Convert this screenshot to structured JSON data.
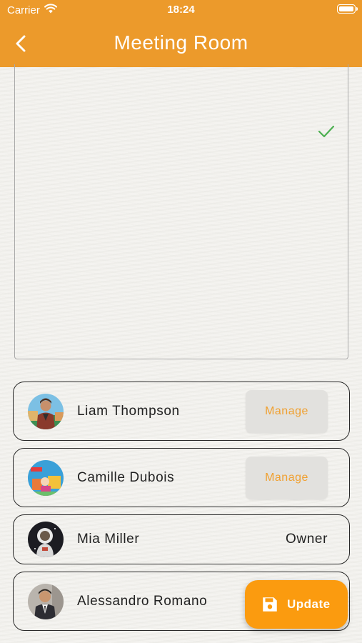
{
  "status_bar": {
    "carrier": "Carrier",
    "time": "18:24"
  },
  "header": {
    "title": "Meeting Room",
    "back_icon": "chevron-left-icon"
  },
  "content_box": {
    "status_icon": "checkmark-icon",
    "check_color": "#4caf50"
  },
  "participants": [
    {
      "name": "Liam Thompson",
      "action": "Manage"
    },
    {
      "name": "Camille Dubois",
      "action": "Manage"
    },
    {
      "name": "Mia Miller",
      "role": "Owner"
    },
    {
      "name": "Alessandro Romano"
    }
  ],
  "update_button": {
    "label": "Update",
    "icon": "save-icon"
  },
  "colors": {
    "header": "#ec9a2b",
    "accent": "#fb9b0f",
    "manage_text": "#f0a030"
  }
}
